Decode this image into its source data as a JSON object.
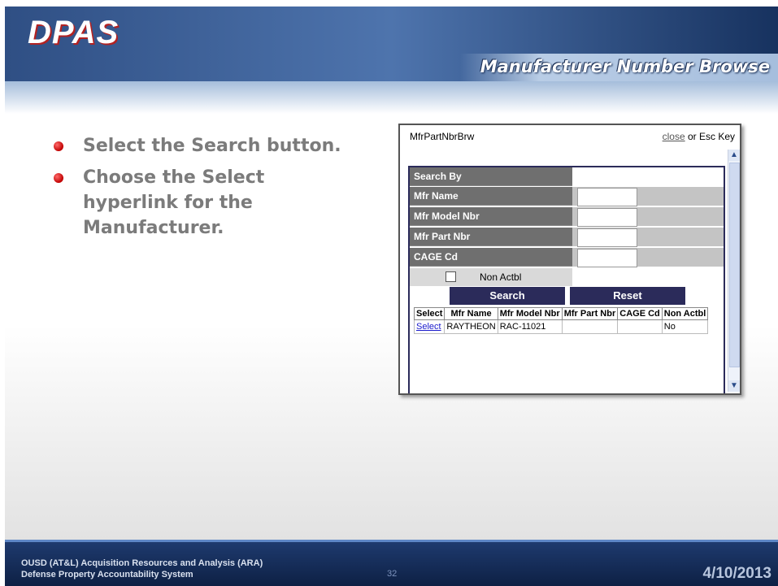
{
  "logo": {
    "text": "DPAS"
  },
  "slide": {
    "title": "Manufacturer Number Browse"
  },
  "bullets": [
    "Select the Search button.",
    "Choose the Select hyperlink for the Manufacturer."
  ],
  "panel": {
    "title": "MfrPartNbrBrw",
    "close_link": "close",
    "close_suffix": " or Esc Key",
    "search_by_label": "Search By",
    "fields": [
      {
        "label": "Mfr Name",
        "value": ""
      },
      {
        "label": "Mfr Model Nbr",
        "value": ""
      },
      {
        "label": "Mfr Part Nbr",
        "value": ""
      },
      {
        "label": "CAGE Cd",
        "value": ""
      }
    ],
    "checkbox_label": "Non Actbl",
    "checkbox_checked": false,
    "search_button": "Search",
    "reset_button": "Reset",
    "table": {
      "headers": [
        "Select",
        "Mfr Name",
        "Mfr Model Nbr",
        "Mfr Part Nbr",
        "CAGE Cd",
        "Non Actbl"
      ],
      "rows": [
        [
          "Select",
          "RAYTHEON",
          "RAC-11021",
          "",
          "",
          "No"
        ]
      ]
    }
  },
  "footer": {
    "line1": "OUSD (AT&L) Acquisition Resources and Analysis (ARA)",
    "line2": "Defense Property Accountability System",
    "page": "32",
    "date": "4/10/2013"
  },
  "colors": {
    "header": "#2f4f84",
    "bullet": "#c00000",
    "panel_button": "#2b2b5a",
    "footer": "#1e3a6e"
  },
  "icons": [
    "scroll-up-arrow-icon",
    "scroll-down-arrow-icon",
    "bullet-dot-icon"
  ]
}
